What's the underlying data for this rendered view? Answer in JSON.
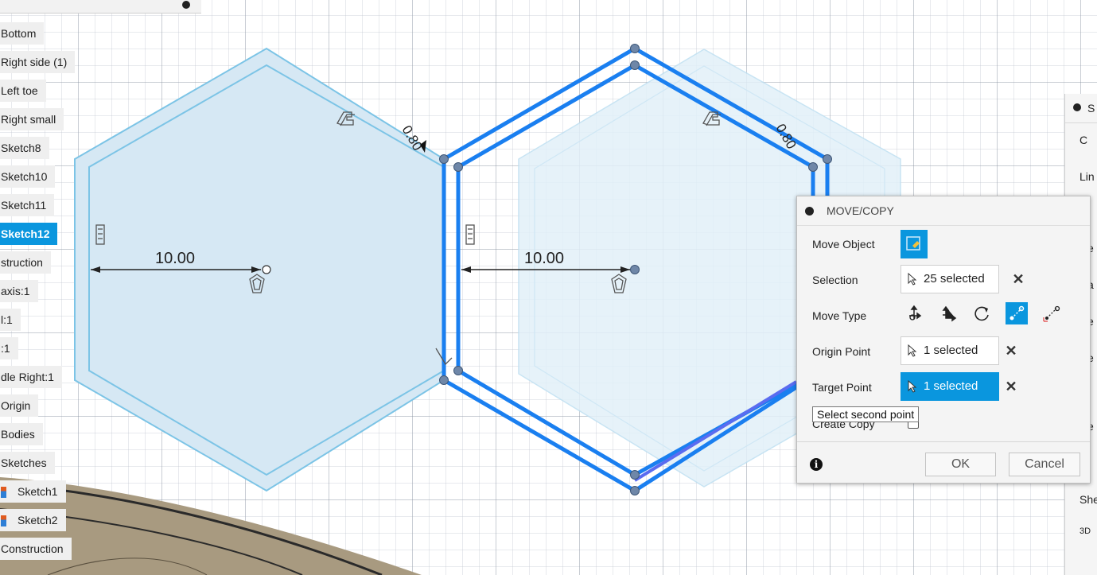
{
  "browser": {
    "items": [
      {
        "label": "Bottom",
        "selected": false,
        "icon": ""
      },
      {
        "label": "Right side (1)",
        "selected": false,
        "icon": ""
      },
      {
        "label": "Left toe",
        "selected": false,
        "icon": ""
      },
      {
        "label": "Right small",
        "selected": false,
        "icon": ""
      },
      {
        "label": "Sketch8",
        "selected": false,
        "icon": ""
      },
      {
        "label": "Sketch10",
        "selected": false,
        "icon": ""
      },
      {
        "label": "Sketch11",
        "selected": false,
        "icon": ""
      },
      {
        "label": "Sketch12",
        "selected": true,
        "icon": ""
      },
      {
        "label": "struction",
        "selected": false,
        "icon": ""
      },
      {
        "label": "axis:1",
        "selected": false,
        "icon": ""
      },
      {
        "label": "l:1",
        "selected": false,
        "icon": ""
      },
      {
        "label": ":1",
        "selected": false,
        "icon": ""
      },
      {
        "label": "dle Right:1",
        "selected": false,
        "icon": ""
      },
      {
        "label": "Origin",
        "selected": false,
        "icon": ""
      },
      {
        "label": "Bodies",
        "selected": false,
        "icon": ""
      },
      {
        "label": "Sketches",
        "selected": false,
        "icon": ""
      },
      {
        "label": "Sketch1",
        "selected": false,
        "icon": "sketch-icon"
      },
      {
        "label": "Sketch2",
        "selected": false,
        "icon": "sketch-icon"
      },
      {
        "label": "Construction",
        "selected": false,
        "icon": ""
      }
    ]
  },
  "sketch": {
    "dim_left": "10.00",
    "dim_right": "10.00",
    "offset_left": "0.80",
    "offset_right": "0.80",
    "colors": {
      "selected_line": "#1a7ff0",
      "offset_line": "#7cc4e6",
      "fill": "#d6e8f4",
      "point": "#6f87a8"
    }
  },
  "dialog": {
    "title": "MOVE/COPY",
    "move_object_label": "Move Object",
    "selection_label": "Selection",
    "selection_value": "25 selected",
    "move_type_label": "Move Type",
    "origin_point_label": "Origin Point",
    "origin_point_value": "1 selected",
    "target_point_label": "Target Point",
    "target_point_value": "1 selected",
    "create_copy_label": "Create Copy",
    "tooltip": "Select second point",
    "ok_label": "OK",
    "cancel_label": "Cancel",
    "accent": "#0a96de"
  },
  "side_panel": {
    "texts": [
      "S",
      "C",
      "Lin",
      "e",
      "a",
      "e",
      "e",
      "e",
      "She",
      "3D"
    ]
  }
}
